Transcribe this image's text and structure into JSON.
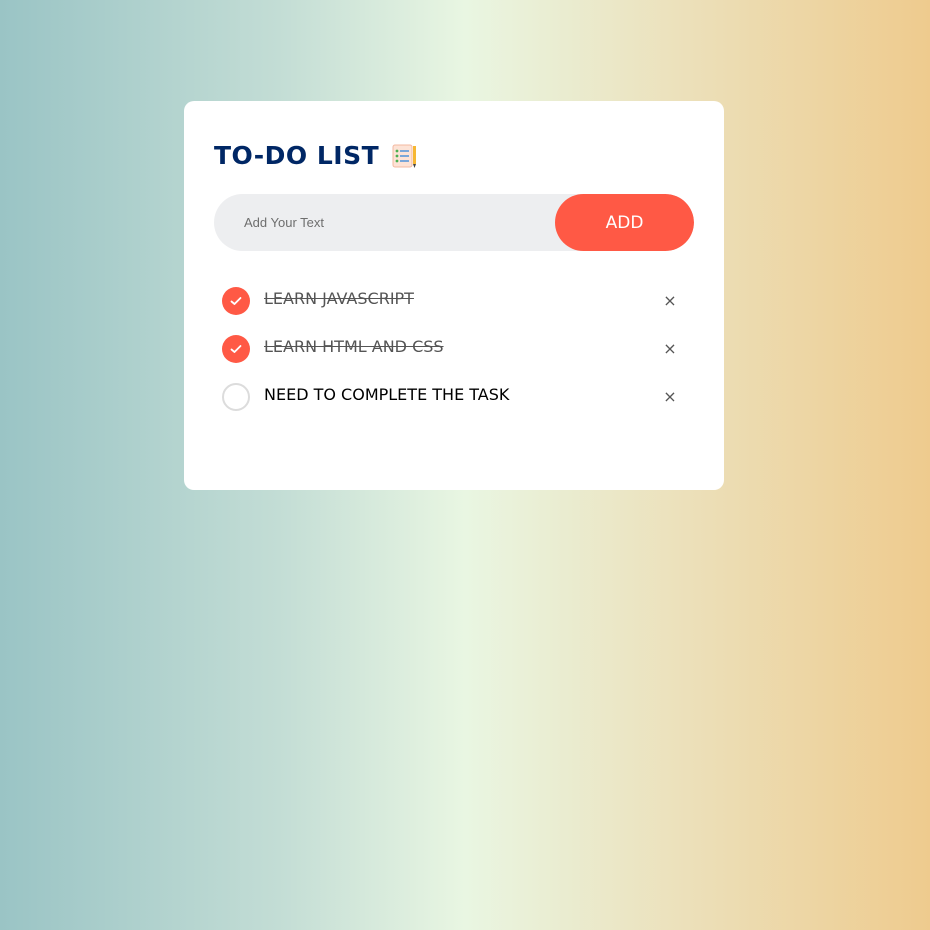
{
  "app": {
    "title": "TO-DO LIST",
    "title_icon": "clipboard-list-icon"
  },
  "input": {
    "value": "",
    "placeholder": "Add Your Text"
  },
  "add_button": {
    "label": "ADD"
  },
  "tasks": [
    {
      "text": "LEARN JAVASCRIPT",
      "checked": true,
      "delete_label": "×"
    },
    {
      "text": "LEARN HTML AND CSS",
      "checked": true,
      "delete_label": "×"
    },
    {
      "text": "NEED TO COMPLETE THE TASK",
      "checked": false,
      "delete_label": "×"
    }
  ],
  "colors": {
    "accent": "#ff5945",
    "title": "#002765",
    "input_bg": "#edeef0",
    "card_bg": "#ffffff"
  }
}
